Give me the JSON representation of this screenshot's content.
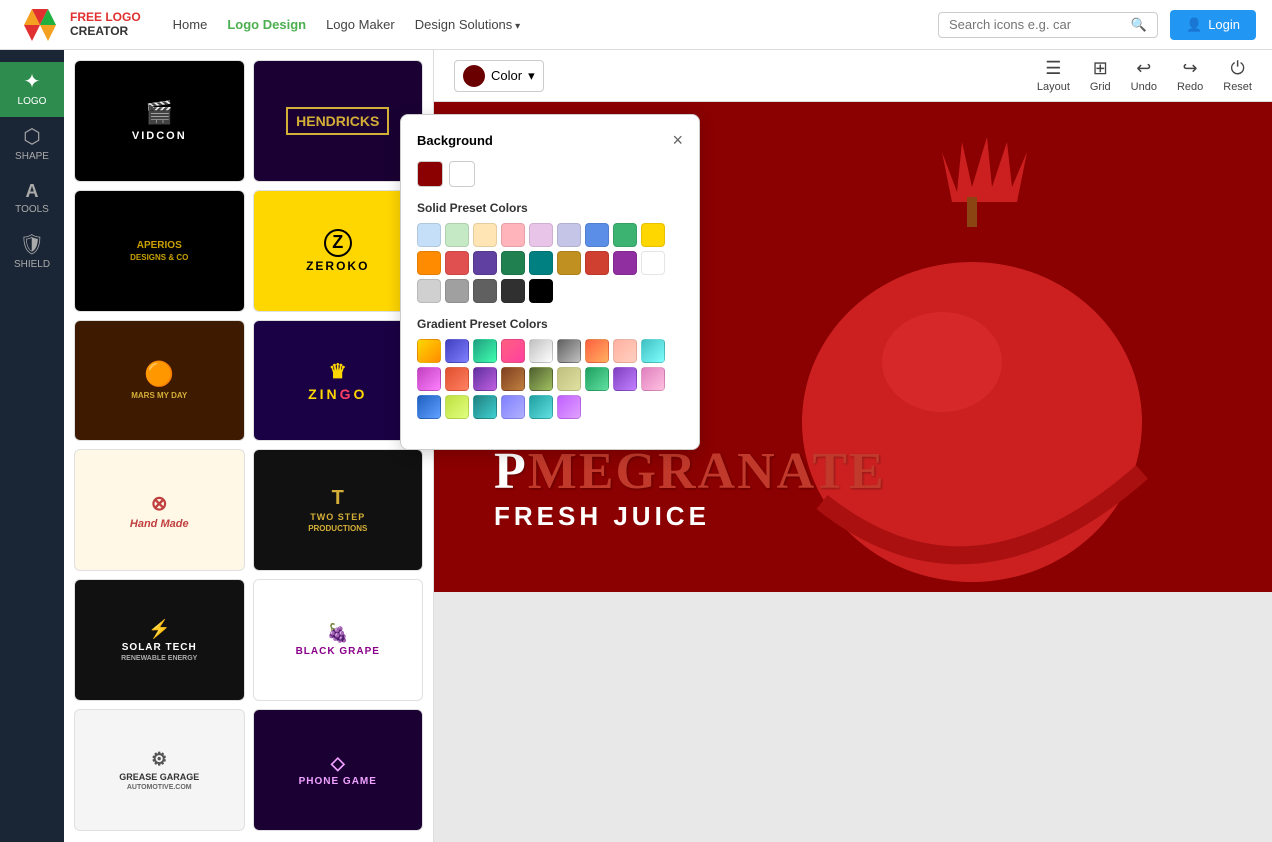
{
  "navbar": {
    "brand": "FREE LOGO\nCREATOR",
    "links": [
      {
        "label": "Home",
        "active": false,
        "has_arrow": false
      },
      {
        "label": "Logo Design",
        "active": true,
        "has_arrow": false
      },
      {
        "label": "Logo Maker",
        "active": false,
        "has_arrow": false
      },
      {
        "label": "Design Solutions",
        "active": false,
        "has_arrow": true
      }
    ],
    "search_placeholder": "Search icons e.g. car",
    "login_label": "Login"
  },
  "sidebar": {
    "tools": [
      {
        "id": "logo",
        "label": "LOGO",
        "active": true,
        "icon": "✦"
      },
      {
        "id": "shape",
        "label": "SHAPE",
        "active": false,
        "icon": "⬡"
      },
      {
        "id": "tools",
        "label": "TOOLS",
        "active": false,
        "icon": "A"
      },
      {
        "id": "shield",
        "label": "SHIELD",
        "active": false,
        "icon": "🛡"
      }
    ]
  },
  "toolbar": {
    "color_label": "Color",
    "layout_label": "Layout",
    "grid_label": "Grid",
    "undo_label": "Undo",
    "redo_label": "Redo",
    "reset_label": "Reset"
  },
  "canvas": {
    "main_text": "MEGRANATE",
    "first_letter": "P",
    "sub_text": "FRESH JUICE"
  },
  "color_popup": {
    "title": "Background",
    "close_label": "×",
    "solid_section": "Solid Preset Colors",
    "gradient_section": "Gradient Preset Colors",
    "bg_colors": [
      "#8b0000",
      "#ffffff"
    ],
    "solid_colors": [
      "#c5dff8",
      "#c5e8c5",
      "#ffe5b4",
      "#ffb3ba",
      "#e8c5e8",
      "#c5c5e8",
      "#5b8ee6",
      "#3cb371",
      "#ffd700",
      "#ff8c00",
      "#e05050",
      "#6040a0",
      "#208050",
      "#008080",
      "#c09020",
      "#d04030",
      "#9030a0",
      "#ffffff",
      "#d0d0d0",
      "#a0a0a0",
      "#606060",
      "#303030",
      "#000000"
    ],
    "gradient_colors": [
      {
        "c1": "#ffd700",
        "c2": "#ff8c00"
      },
      {
        "c1": "#4040c0",
        "c2": "#8080ff"
      },
      {
        "c1": "#20a080",
        "c2": "#40ffb0"
      },
      {
        "c1": "#ff6080",
        "c2": "#ff40a0"
      },
      {
        "c1": "#c0c0c0",
        "c2": "#ffffff"
      },
      {
        "c1": "#606060",
        "c2": "#c0c0c0"
      },
      {
        "c1": "#ff6040",
        "c2": "#ffb060"
      },
      {
        "c1": "#ffb0a0",
        "c2": "#ffd0c0"
      },
      {
        "c1": "#40c0c0",
        "c2": "#80ffff"
      },
      {
        "c1": "#c040c0",
        "c2": "#ff80ff"
      },
      {
        "c1": "#e05030",
        "c2": "#ff8060"
      },
      {
        "c1": "#6030a0",
        "c2": "#c060e0"
      },
      {
        "c1": "#804020",
        "c2": "#c08040"
      },
      {
        "c1": "#506030",
        "c2": "#a0c060"
      },
      {
        "c1": "#c0c080",
        "c2": "#e0e0a0"
      },
      {
        "c1": "#20a060",
        "c2": "#60e0a0"
      },
      {
        "c1": "#8040c0",
        "c2": "#c080ff"
      },
      {
        "c1": "#e080c0",
        "c2": "#ffc0e0"
      },
      {
        "c1": "#2060c0",
        "c2": "#60a0ff"
      },
      {
        "c1": "#c0e040",
        "c2": "#e0ff80"
      },
      {
        "c1": "#208080",
        "c2": "#40d0d0"
      },
      {
        "c1": "#8080ff",
        "c2": "#b0b0ff"
      },
      {
        "c1": "#20a0a0",
        "c2": "#60e0e0"
      },
      {
        "c1": "#c060ff",
        "c2": "#e0a0ff"
      }
    ]
  },
  "gallery": {
    "items": [
      {
        "id": "vidcon",
        "label": "VIDCON",
        "class": "logo-vidcon"
      },
      {
        "id": "hendricks",
        "label": "HENDRICKS",
        "class": "logo-hendricks"
      },
      {
        "id": "aperios",
        "label": "APERIOS DESIGNS & CO",
        "class": "logo-aperios"
      },
      {
        "id": "zeroko",
        "label": "ZEROKO",
        "class": "logo-zeroko"
      },
      {
        "id": "marsmyday",
        "label": "MARS MY DAY",
        "class": "logo-marsmyday"
      },
      {
        "id": "zingo",
        "label": "ZINGO",
        "class": "logo-zingo"
      },
      {
        "id": "handmade",
        "label": "Hand Made",
        "class": "logo-handmade"
      },
      {
        "id": "twostep",
        "label": "TWO STEP PRODUCTIONS",
        "class": "logo-twostep"
      },
      {
        "id": "solartech",
        "label": "SOLAR TECH",
        "class": "logo-solartech"
      },
      {
        "id": "blackgrape",
        "label": "BLACK GRAPE",
        "class": "logo-blackgrape"
      },
      {
        "id": "grease",
        "label": "GREASE GARAGE AUTOMOTIVE",
        "class": "logo-grease"
      },
      {
        "id": "phonegame",
        "label": "PHONE GAME",
        "class": "logo-phonegame"
      }
    ]
  }
}
